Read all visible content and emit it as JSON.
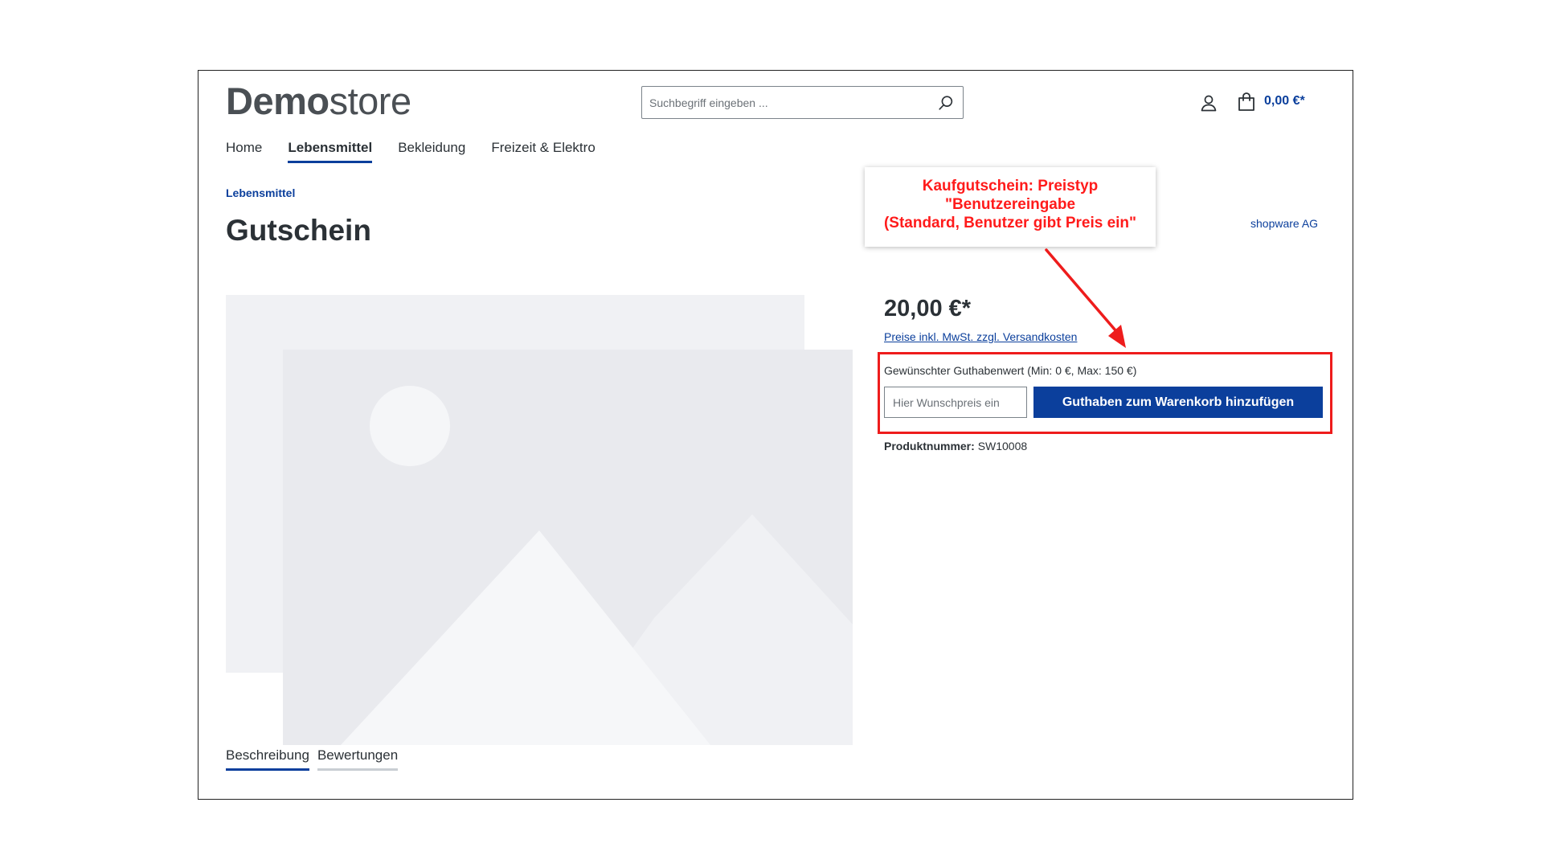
{
  "header": {
    "logo_bold": "Demo",
    "logo_light": "store",
    "search_placeholder": "Suchbegriff eingeben ...",
    "cart_total": "0,00 €*"
  },
  "nav": {
    "items": [
      {
        "label": "Home",
        "active": false
      },
      {
        "label": "Lebensmittel",
        "active": true
      },
      {
        "label": "Bekleidung",
        "active": false
      },
      {
        "label": "Freizeit & Elektro",
        "active": false
      }
    ]
  },
  "product": {
    "breadcrumb": "Lebensmittel",
    "title": "Gutschein",
    "manufacturer": "shopware AG",
    "price": "20,00 €*",
    "tax_link": "Preise inkl. MwSt. zzgl. Versandkosten",
    "voucher_label": "Gewünschter Guthabenwert (Min: 0 €, Max: 150 €)",
    "wish_placeholder": "Hier Wunschpreis ein",
    "add_button": "Guthaben zum Warenkorb hinzufügen",
    "product_number_label": "Produktnummer:",
    "product_number": "SW10008"
  },
  "tabs": [
    {
      "label": "Beschreibung",
      "active": true
    },
    {
      "label": "Bewertungen",
      "active": false
    }
  ],
  "annotation": {
    "lines": [
      "Kaufgutschein: Preistyp",
      "\"Benutzereingabe",
      "(Standard, Benutzer gibt Preis ein\""
    ],
    "color": "#ee1c1c"
  },
  "colors": {
    "brand": "#0b3f9c",
    "text": "#2b3136",
    "placeholder_back": "#f0f1f4",
    "placeholder_front": "#e9eaee"
  }
}
